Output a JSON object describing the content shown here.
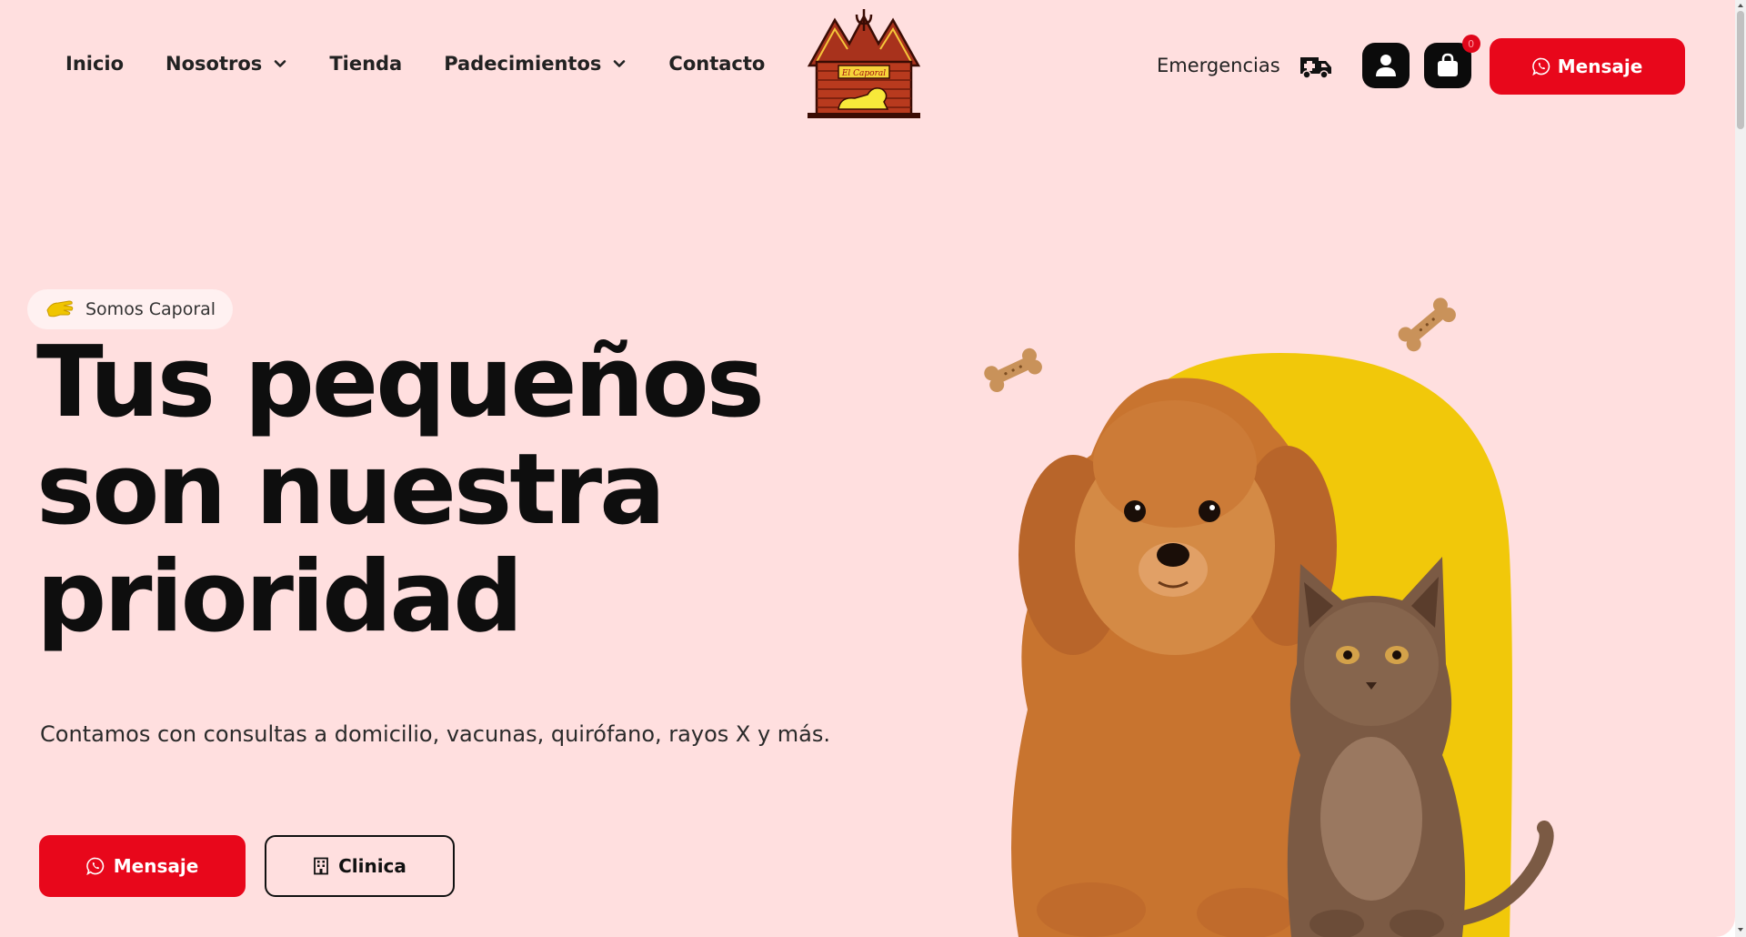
{
  "nav": {
    "items": [
      {
        "label": "Inicio",
        "dropdown": false
      },
      {
        "label": "Nosotros",
        "dropdown": true
      },
      {
        "label": "Tienda",
        "dropdown": false
      },
      {
        "label": "Padecimientos",
        "dropdown": true
      },
      {
        "label": "Contacto",
        "dropdown": false
      }
    ]
  },
  "logo": {
    "text": "El Caporal"
  },
  "header": {
    "emergencias_label": "Emergencias",
    "cart_count": "0",
    "message_button": "Mensaje"
  },
  "hero": {
    "badge": "Somos Caporal",
    "headline_line1": "Tus pequeños",
    "headline_line2": "son nuestra",
    "headline_line3": "prioridad",
    "subtitle": "Contamos con consultas a domicilio, vacunas, quirófano, rayos X y más.",
    "primary_button": "Mensaje",
    "secondary_button": "Clinica"
  },
  "icons": {
    "ambulance": "ambulance-icon",
    "user": "user-icon",
    "cart": "shopping-bag-icon",
    "whatsapp": "whatsapp-icon",
    "building": "building-icon",
    "bone": "bone-icon",
    "chevron": "chevron-down-icon"
  },
  "colors": {
    "background": "#ffdfdf",
    "accent_red": "#e8071b",
    "accent_yellow": "#f1c80a",
    "text_dark": "#0e0e0e"
  }
}
